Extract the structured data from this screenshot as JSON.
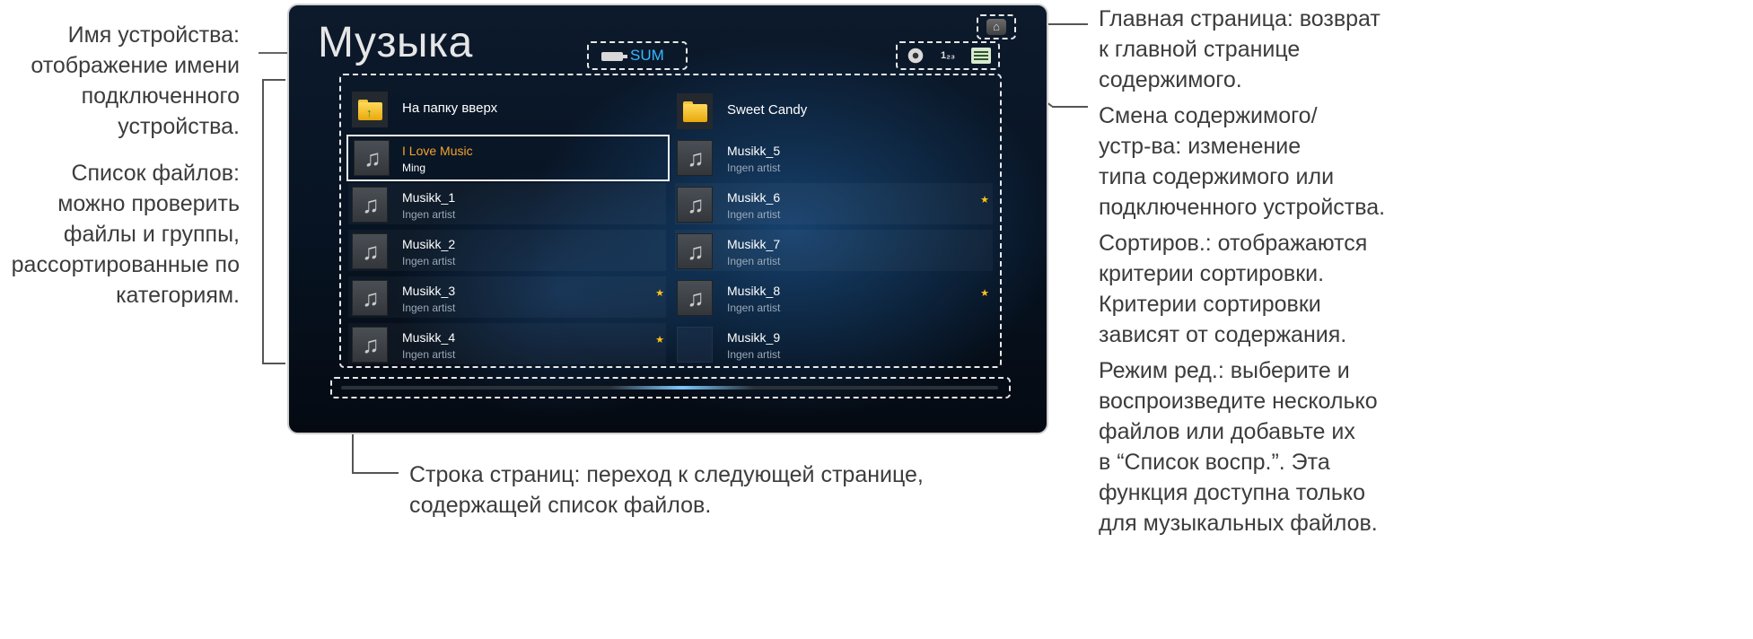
{
  "screen": {
    "title": "Музыка",
    "device_name": "SUM",
    "home_icon": "home-icon",
    "tools": [
      "content-device-change-icon",
      "sort-icon",
      "edit-mode-icon"
    ],
    "sort_icon_text": "1₂₃",
    "folders": [
      {
        "label": "На папку вверх",
        "icon": "folder-up-icon"
      },
      {
        "label": "Sweet Candy",
        "icon": "folder-icon"
      }
    ],
    "files_left": [
      {
        "title": "I Love Music",
        "artist": "Ming",
        "selected": true,
        "favorite": false
      },
      {
        "title": "Musikk_1",
        "artist": "Ingen artist",
        "favorite": false
      },
      {
        "title": "Musikk_2",
        "artist": "Ingen artist",
        "favorite": false
      },
      {
        "title": "Musikk_3",
        "artist": "Ingen artist",
        "favorite": true
      },
      {
        "title": "Musikk_4",
        "artist": "Ingen artist",
        "favorite": true
      }
    ],
    "files_right": [
      {
        "title": "Musikk_5",
        "artist": "Ingen artist",
        "favorite": false
      },
      {
        "title": "Musikk_6",
        "artist": "Ingen artist",
        "favorite": true
      },
      {
        "title": "Musikk_7",
        "artist": "Ingen artist",
        "favorite": false
      },
      {
        "title": "Musikk_8",
        "artist": "Ingen artist",
        "favorite": true
      },
      {
        "title": "Musikk_9",
        "artist": "Ingen artist",
        "favorite": false,
        "no_thumb": true
      }
    ],
    "colors": {
      "selected_title": "#f4a42a",
      "device_name": "#35b8ff",
      "favorite_star": "#ffc21a"
    }
  },
  "annotations": {
    "device": [
      "Имя устройства:",
      "отображение имени",
      "подключенного",
      "устройства."
    ],
    "filelist": [
      "Список файлов:",
      "можно проверить",
      "файлы и группы,",
      "рассортированные по",
      "категориям."
    ],
    "home": [
      "Главная страница: возврат",
      "к главной странице",
      "содержимого."
    ],
    "change": [
      "Смена содержимого/",
      "устр-ва: изменение",
      "типа содержимого или",
      "подключенного устройства."
    ],
    "sort": [
      "Сортиров.: отображаются",
      "критерии сортировки.",
      "Критерии сортировки",
      "зависят от содержания."
    ],
    "edit": [
      "Режим ред.: выберите и",
      "воспроизведите несколько",
      "файлов или добавьте их",
      "в “Список воспр.”. Эта",
      "функция доступна только",
      "для музыкальных файлов."
    ],
    "pagebar": [
      "Строка страниц: переход к следующей странице,",
      "содержащей список файлов."
    ]
  }
}
